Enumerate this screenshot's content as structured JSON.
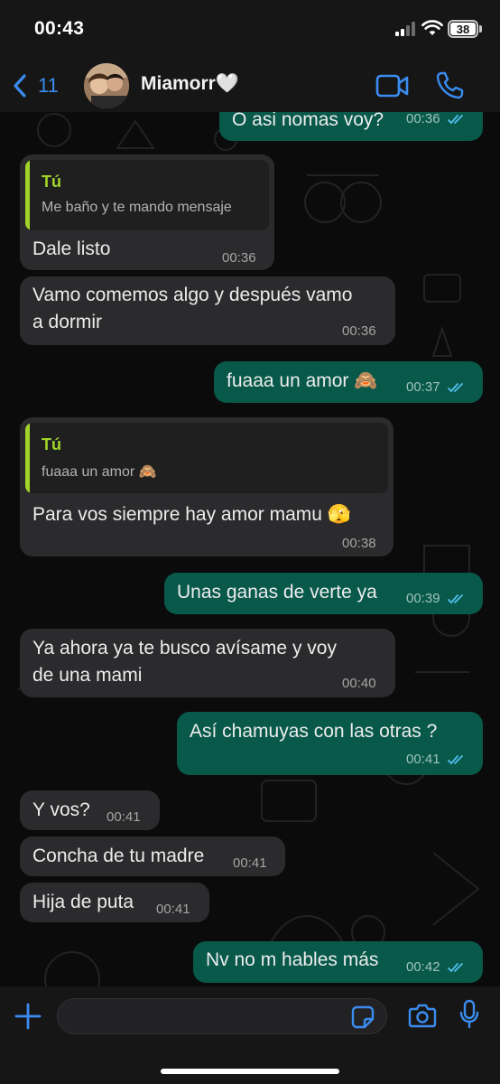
{
  "status_bar": {
    "time": "00:43",
    "battery": "38"
  },
  "header": {
    "back_count": "11",
    "contact_name": "Miamorr🤍"
  },
  "messages": [
    {
      "dir": "out",
      "text": "O asi nomas voy?",
      "time": "00:36",
      "read": true
    },
    {
      "dir": "in",
      "quote_author": "Tú",
      "quote_text": "Me baño y te mando mensaje",
      "text": "Dale listo",
      "time": "00:36"
    },
    {
      "dir": "in",
      "text": "Vamo comemos algo y después vamo\na dormir",
      "time": "00:36"
    },
    {
      "dir": "out",
      "text": "fuaaa un amor 🙈",
      "time": "00:37",
      "read": true
    },
    {
      "dir": "in",
      "quote_author": "Tú",
      "quote_text": "fuaaa un amor 🙈",
      "text": "Para vos siempre hay amor mamu 🫣",
      "time": "00:38"
    },
    {
      "dir": "out",
      "text": "Unas ganas de verte ya",
      "time": "00:39",
      "read": true
    },
    {
      "dir": "in",
      "text": "Ya ahora ya te busco avísame y voy\nde una mami",
      "time": "00:40"
    },
    {
      "dir": "out",
      "text": "Así chamuyas con las otras ?",
      "time": "00:41",
      "read": true
    },
    {
      "dir": "in",
      "text": "Y vos?",
      "time": "00:41"
    },
    {
      "dir": "in",
      "text": "Concha de tu madre",
      "time": "00:41"
    },
    {
      "dir": "in",
      "text": "Hija de puta",
      "time": "00:41"
    },
    {
      "dir": "out",
      "text": "Nv no m hables más",
      "time": "00:42",
      "read": true
    }
  ],
  "input": {
    "placeholder": ""
  },
  "colors": {
    "incoming_bubble": "#2b2b2d",
    "outgoing_bubble": "#08594a",
    "accent_blue": "#3b8cf0",
    "read_tick_blue": "#53bdeb",
    "quote_accent": "#a2d42a"
  },
  "icons": {
    "back": "chevron-left-icon",
    "video": "video-camera-icon",
    "call": "phone-icon",
    "add": "plus-icon",
    "sticker": "sticker-icon",
    "camera": "camera-icon",
    "mic": "microphone-icon"
  }
}
